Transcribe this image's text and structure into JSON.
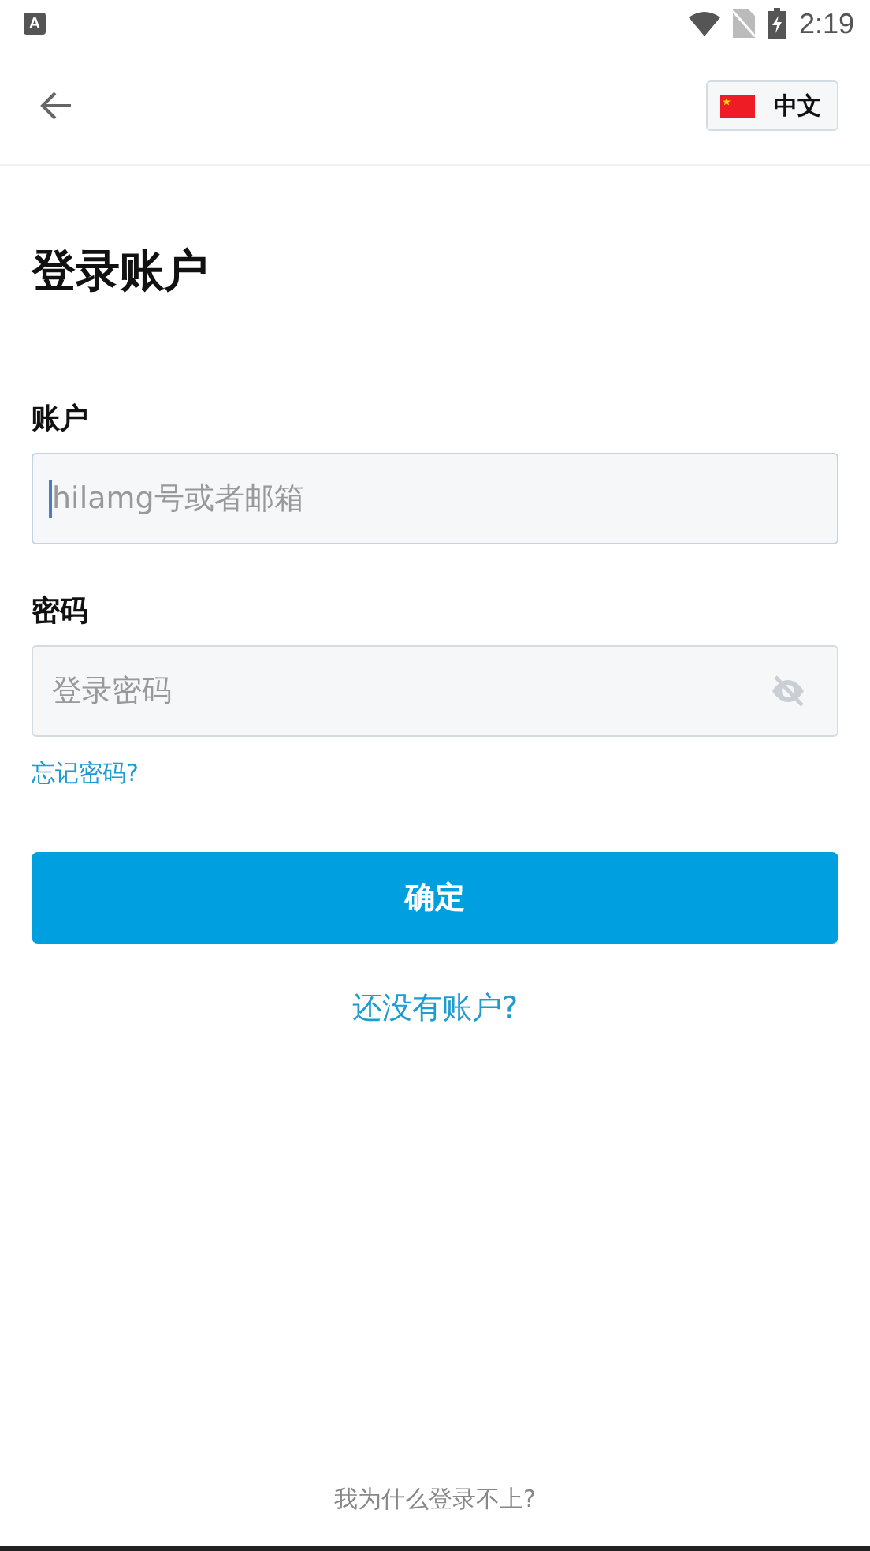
{
  "status_bar": {
    "notification_icon": "A",
    "time": "2:19"
  },
  "header": {
    "language": "中文"
  },
  "title": "登录账户",
  "fields": [
    {
      "label": "账户",
      "placeholder": "hilamg号或者邮箱",
      "focused": true,
      "kind": "text"
    },
    {
      "label": "密码",
      "placeholder": "登录密码",
      "focused": false,
      "kind": "password"
    }
  ],
  "forgot_link": "忘记密码?",
  "submit": "确定",
  "signup_link": "还没有账户?",
  "help_link": "我为什么登录不上?"
}
